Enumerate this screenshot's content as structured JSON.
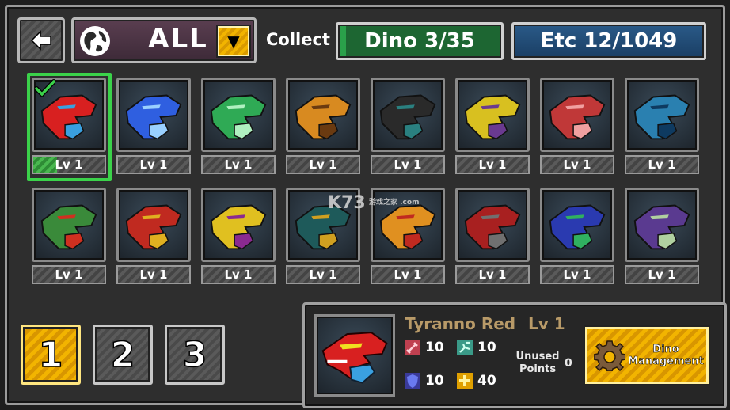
{
  "header": {
    "filter_value": "ALL",
    "collect_label": "Collect",
    "dino_count": "Dino 3/35",
    "etc_count": "Etc 12/1049"
  },
  "grid": {
    "cards": [
      {
        "name": "tyranno-red",
        "level": "Lv 1",
        "selected": true,
        "color": "#d82020",
        "accent": "#3aa0e0"
      },
      {
        "name": "blue-triceratops",
        "level": "Lv 1",
        "color": "#2f5fe0",
        "accent": "#9ad0ff"
      },
      {
        "name": "green-drill",
        "level": "Lv 1",
        "color": "#2faa55",
        "accent": "#b0f0c0"
      },
      {
        "name": "orange-dino",
        "level": "Lv 1",
        "color": "#d88a20",
        "accent": "#6a3a10"
      },
      {
        "name": "black-sabertooth",
        "level": "Lv 1",
        "color": "#2a2a2a",
        "accent": "#2a8080"
      },
      {
        "name": "yellow-ptera",
        "level": "Lv 1",
        "color": "#d8c020",
        "accent": "#6a3a90"
      },
      {
        "name": "red-stego",
        "level": "Lv 1",
        "color": "#c03838",
        "accent": "#f0a0a0"
      },
      {
        "name": "blue-brachio",
        "level": "Lv 1",
        "color": "#2a80b0",
        "accent": "#0e3a60"
      },
      {
        "name": "green-pachy",
        "level": "Lv 1",
        "color": "#3a8a3a",
        "accent": "#d03020"
      },
      {
        "name": "red-gold-raptor",
        "level": "Lv 1",
        "color": "#c02a20",
        "accent": "#e0b020"
      },
      {
        "name": "purple-yellow-dino",
        "level": "Lv 1",
        "color": "#e0c020",
        "accent": "#8a2a90"
      },
      {
        "name": "teal-spino",
        "level": "Lv 1",
        "color": "#1e5a5a",
        "accent": "#d0a020"
      },
      {
        "name": "yellow-red-dino",
        "level": "Lv 1",
        "color": "#e09020",
        "accent": "#c02a20"
      },
      {
        "name": "red-gun-dino",
        "level": "Lv 1",
        "color": "#a82020",
        "accent": "#707070"
      },
      {
        "name": "blue-green-dino",
        "level": "Lv 1",
        "color": "#2a3ab0",
        "accent": "#30b060"
      },
      {
        "name": "purple-mammoth",
        "level": "Lv 1",
        "color": "#5a3a90",
        "accent": "#b0d0a0"
      }
    ]
  },
  "pages": [
    "1",
    "2",
    "3"
  ],
  "active_page": "1",
  "detail": {
    "name": "Tyranno Red",
    "level": "Lv 1",
    "attack": "10",
    "speed": "10",
    "defense": "10",
    "bonus": "40",
    "unused_label": "Unused Points",
    "unused_value": "0",
    "management_label": "Dino Management"
  },
  "watermark": {
    "text": "K73",
    "sub": "游戏之家 .com"
  },
  "colors": {
    "selected_border": "#3bd24a",
    "page_active": "#f2b400",
    "dino_counter": "#1d6632",
    "etc_counter": "#1a3e64"
  }
}
